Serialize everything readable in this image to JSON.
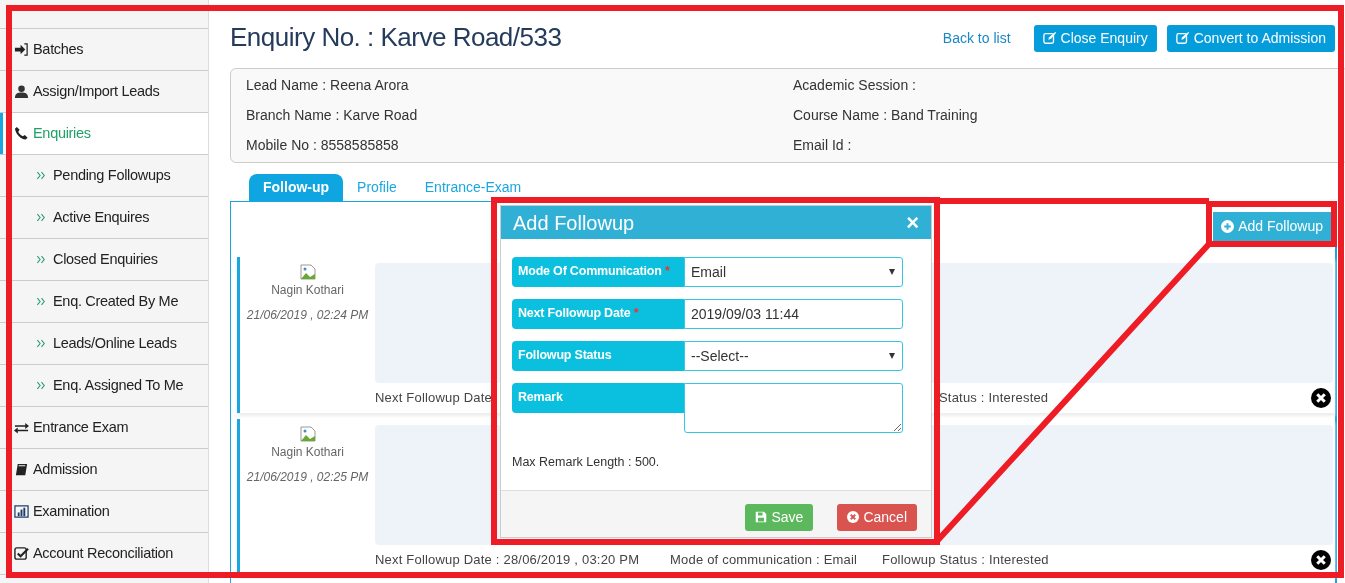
{
  "sidebar": {
    "items": [
      {
        "label": "Batches",
        "kind": "main",
        "selected": false
      },
      {
        "label": "Assign/Import Leads",
        "kind": "main",
        "selected": false
      },
      {
        "label": "Enquiries",
        "kind": "main",
        "selected": true
      },
      {
        "label": "Pending Followups",
        "kind": "sub",
        "selected": false
      },
      {
        "label": "Active Enquires",
        "kind": "sub",
        "selected": false
      },
      {
        "label": "Closed Enquiries",
        "kind": "sub",
        "selected": false
      },
      {
        "label": "Enq. Created By Me",
        "kind": "sub",
        "selected": false
      },
      {
        "label": "Leads/Online Leads",
        "kind": "sub",
        "selected": false
      },
      {
        "label": "Enq. Assigned To Me",
        "kind": "sub",
        "selected": false
      },
      {
        "label": "Entrance Exam",
        "kind": "main",
        "selected": false
      },
      {
        "label": "Admission",
        "kind": "main",
        "selected": false
      },
      {
        "label": "Examination",
        "kind": "main",
        "selected": false
      },
      {
        "label": "Account Reconciliation",
        "kind": "main",
        "selected": false
      }
    ]
  },
  "header": {
    "title": "Enquiry No. : Karve Road/533",
    "back_link": "Back to list",
    "buttons": [
      "Close Enquiry",
      "Convert to Admission"
    ]
  },
  "info": {
    "left": [
      "Lead Name : Reena Arora",
      "Branch Name : Karve Road",
      "Mobile No : 8558585858"
    ],
    "right": [
      "Academic Session :",
      "Course Name : Band Training",
      "Email Id :"
    ]
  },
  "tabs": [
    {
      "label": "Follow-up",
      "selected": true
    },
    {
      "label": "Profile",
      "selected": false
    },
    {
      "label": "Entrance-Exam",
      "selected": false
    }
  ],
  "add_button": "Add Followup",
  "followups": [
    {
      "name": "Nagin Kothari",
      "date": "21/06/2019 , 02:24 PM",
      "footer": [
        {
          "kind": "next_date",
          "text": "Next Followup Date"
        },
        {
          "kind": "status_tail",
          "text": "Status : Interested"
        }
      ]
    },
    {
      "name": "Nagin Kothari",
      "date": "21/06/2019 , 02:25 PM",
      "footer": [
        {
          "kind": "next_date",
          "text": "Next Followup Date : 28/06/2019 , 03:20 PM"
        },
        {
          "kind": "mode",
          "text": "Mode of communication : Email"
        },
        {
          "kind": "status",
          "text": "Followup Status : Interested"
        }
      ]
    }
  ],
  "modal": {
    "title": "Add Followup",
    "close": "×",
    "fields": [
      {
        "label": "Mode Of Communication",
        "required_mark": "*",
        "kind": "select",
        "value": "Email"
      },
      {
        "label": "Next Followup Date",
        "required_mark": "*",
        "kind": "text",
        "value": "2019/09/03 11:44"
      },
      {
        "label": "Followup Status",
        "kind": "select",
        "value": "--Select--"
      },
      {
        "label": "Remark",
        "kind": "textarea"
      }
    ],
    "note": "Max Remark Length : 500.",
    "buttons": [
      {
        "label": "Save",
        "kind": "save"
      },
      {
        "label": "Cancel",
        "kind": "cancel"
      }
    ]
  }
}
